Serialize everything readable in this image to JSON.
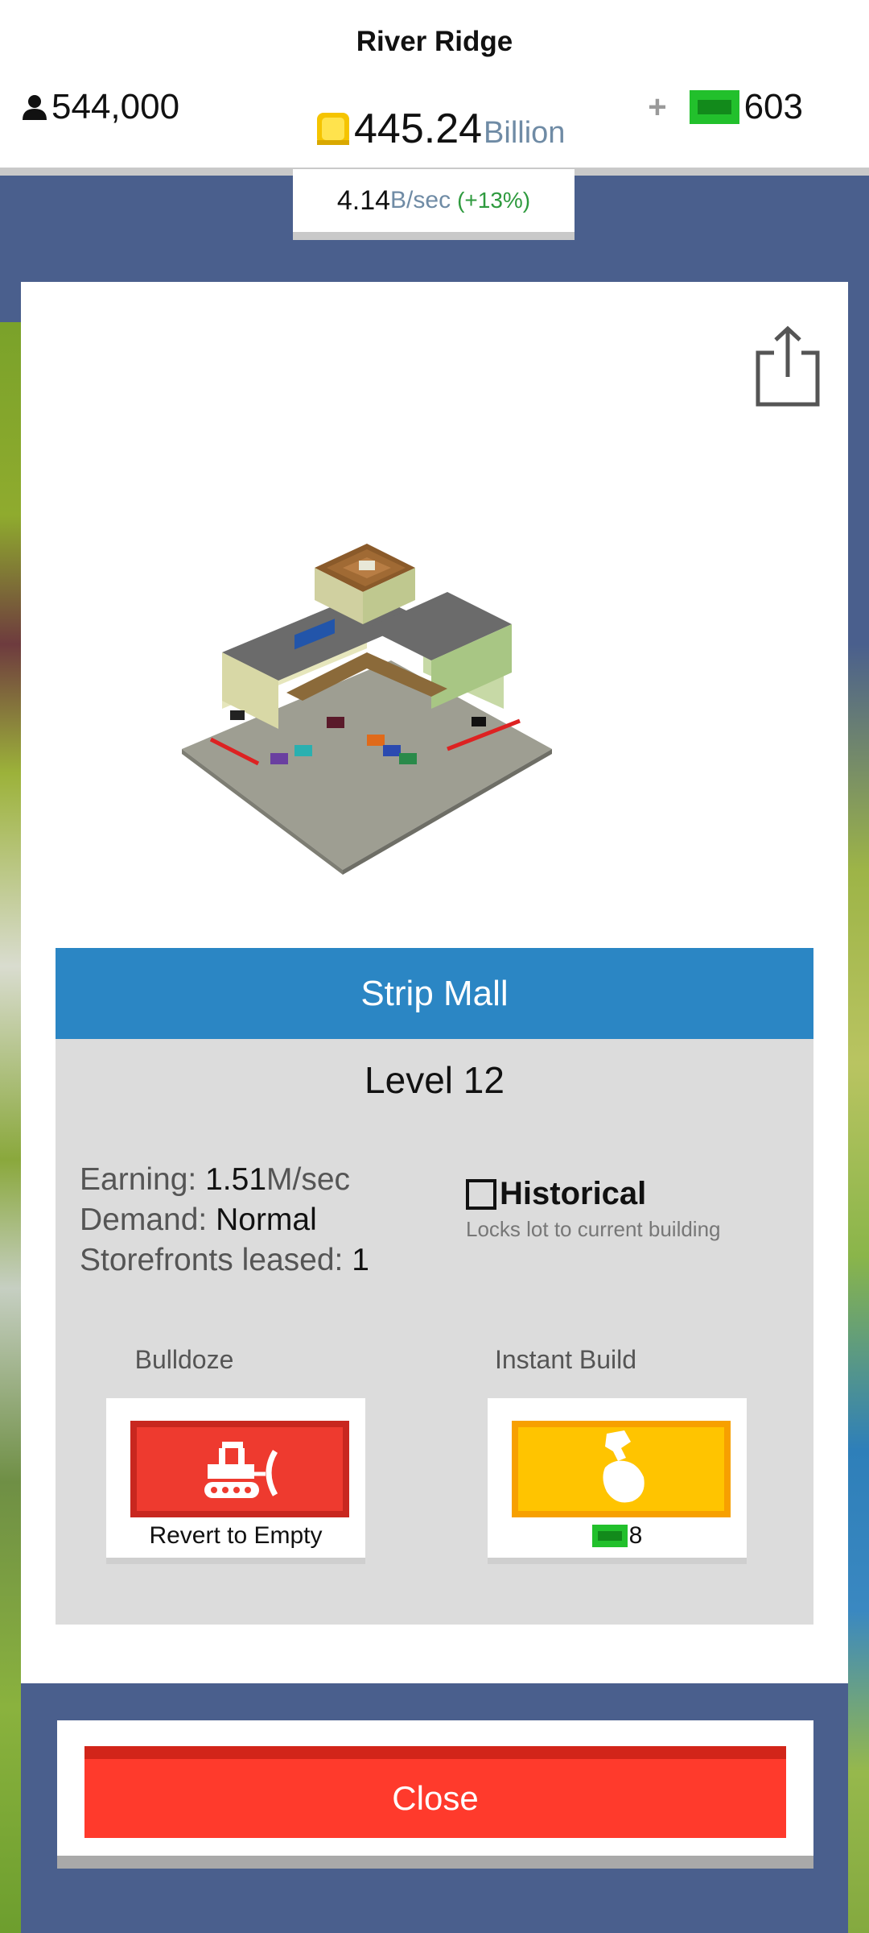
{
  "hud": {
    "city_name": "River Ridge",
    "population": "544,000",
    "coins_value": "445.24",
    "coins_unit": "Billion",
    "cash_value": "603",
    "rate_value": "4.14",
    "rate_unit": "B/sec",
    "rate_change": "(+13%)"
  },
  "building": {
    "name": "Strip Mall",
    "level": "Level 12",
    "earning_label": "Earning: ",
    "earning_value": "1.51",
    "earning_unit": "M/sec",
    "demand_label": "Demand: ",
    "demand_value": "Normal",
    "storefronts_label": "Storefronts leased: ",
    "storefronts_value": "1",
    "historical_label": "Historical",
    "historical_desc": "Locks lot to current building",
    "historical_checked": false
  },
  "actions": {
    "bulldoze_label": "Bulldoze",
    "bulldoze_caption": "Revert to Empty",
    "instant_label": "Instant Build",
    "instant_cost": "8"
  },
  "close_label": "Close",
  "colors": {
    "banner": "#2b86c4",
    "bulldoze": "#ee3a2f",
    "instant_build": "#ffc400",
    "close": "#ff3a2c",
    "backdrop": "#4a5f8d",
    "cash_green": "#22c02c",
    "rate_change": "#2e9a3e"
  },
  "icons": {
    "population": "person-icon",
    "coins": "coin-icon",
    "cash": "cash-icon",
    "share": "share-icon",
    "bulldoze": "bulldozer-icon",
    "instant_build": "hammer-hand-icon"
  }
}
